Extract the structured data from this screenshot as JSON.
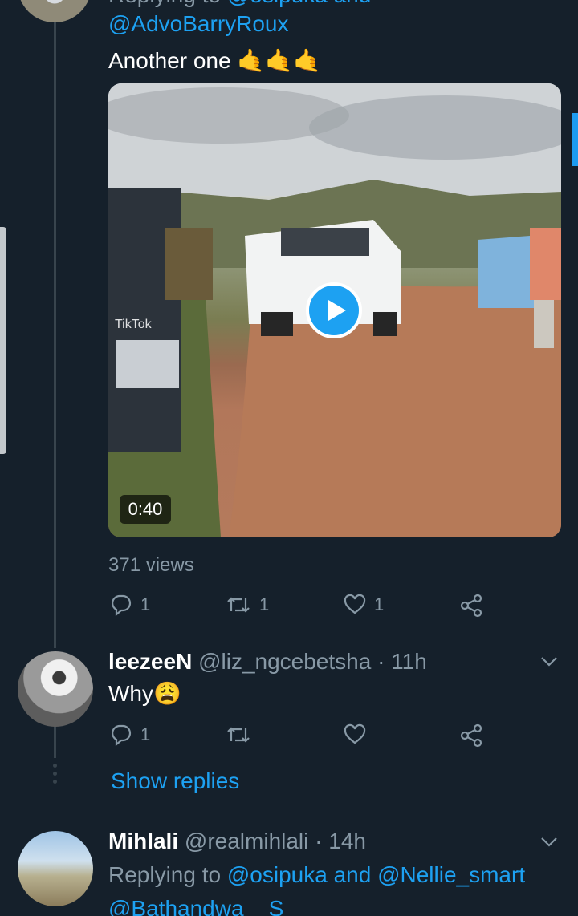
{
  "tweet1": {
    "reply_context_handle": "@AdvoBarryRoux",
    "text": "Another one 🤙🤙🤙",
    "video_duration": "0:40",
    "views": "371 views",
    "reply_count": "1",
    "retweet_count": "1",
    "like_count": "1"
  },
  "tweet2": {
    "display_name": "leezeeN",
    "handle_time": "@liz_ngcebetsha · 11h",
    "text": "Why😩",
    "reply_count": "1",
    "show_replies": "Show replies"
  },
  "tweet3": {
    "display_name": "Mihlali",
    "handle_time": "@realmihlali · 14h",
    "replying_to_prefix": "Replying to ",
    "replying_to_names": "@osipuka and @Nellie_smart",
    "cut_off_line": "@Bathandwa__S"
  },
  "icons": [
    "reply-icon",
    "retweet-icon",
    "like-icon",
    "share-icon",
    "chevron-down-icon",
    "play-icon"
  ],
  "colors": {
    "background": "#15202b",
    "accent": "#1da1f2",
    "muted": "#8899a6",
    "divider": "#38444d"
  }
}
